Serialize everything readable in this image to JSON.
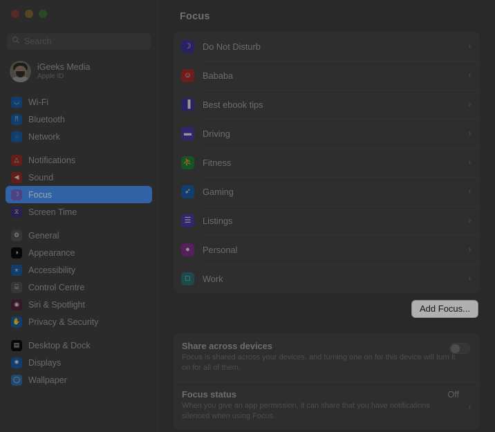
{
  "window": {
    "traffic_lights": [
      "close",
      "minimize",
      "maximize"
    ]
  },
  "sidebar": {
    "search": {
      "placeholder": "Search",
      "value": "",
      "icon": "search-icon"
    },
    "account": {
      "name": "iGeeks Media",
      "subtitle": "Apple ID",
      "avatar": "user-avatar"
    },
    "groups": [
      {
        "items": [
          {
            "label": "Wi-Fi",
            "icon": "wifi-icon",
            "color": "#1a5a9e",
            "glyph": "◡",
            "selected": false
          },
          {
            "label": "Bluetooth",
            "icon": "bluetooth-icon",
            "color": "#1a5a9e",
            "glyph": "ᛗ",
            "selected": false
          },
          {
            "label": "Network",
            "icon": "network-icon",
            "color": "#1a5a9e",
            "glyph": "◌",
            "selected": false
          }
        ]
      },
      {
        "items": [
          {
            "label": "Notifications",
            "icon": "notifications-icon",
            "color": "#8e2b26",
            "glyph": "△",
            "selected": false
          },
          {
            "label": "Sound",
            "icon": "sound-icon",
            "color": "#8e2b26",
            "glyph": "◀",
            "selected": false
          },
          {
            "label": "Focus",
            "icon": "focus-moon-icon",
            "color": "#6d5fc0",
            "glyph": "☽",
            "selected": true
          },
          {
            "label": "Screen Time",
            "icon": "screen-time-icon",
            "color": "#3b3273",
            "glyph": "⧖",
            "selected": false
          }
        ]
      },
      {
        "items": [
          {
            "label": "General",
            "icon": "general-gear-icon",
            "color": "#4f4f4f",
            "glyph": "⚙",
            "selected": false
          },
          {
            "label": "Appearance",
            "icon": "appearance-icon",
            "color": "#0c0c0c",
            "glyph": "◑",
            "selected": false
          },
          {
            "label": "Accessibility",
            "icon": "accessibility-icon",
            "color": "#1a5a9e",
            "glyph": "⚹",
            "selected": false
          },
          {
            "label": "Control Centre",
            "icon": "control-centre-icon",
            "color": "#4f4f4f",
            "glyph": "⌸",
            "selected": false
          },
          {
            "label": "Siri & Spotlight",
            "icon": "siri-icon",
            "color": "#4b2336",
            "glyph": "◉",
            "selected": false
          },
          {
            "label": "Privacy & Security",
            "icon": "privacy-hand-icon",
            "color": "#1a5a9e",
            "glyph": "✋",
            "selected": false
          }
        ]
      },
      {
        "items": [
          {
            "label": "Desktop & Dock",
            "icon": "desktop-dock-icon",
            "color": "#0c0c0c",
            "glyph": "▤",
            "selected": false
          },
          {
            "label": "Displays",
            "icon": "displays-icon",
            "color": "#1a5a9e",
            "glyph": "✹",
            "selected": false
          },
          {
            "label": "Wallpaper",
            "icon": "wallpaper-icon",
            "color": "#2a6a9e",
            "glyph": "◯",
            "selected": false
          }
        ]
      }
    ]
  },
  "main": {
    "title": "Focus",
    "focus_items": [
      {
        "label": "Do Not Disturb",
        "icon": "moon-icon",
        "color": "#3b3391",
        "glyph": "☽",
        "chevron": "›"
      },
      {
        "label": "Bababa",
        "icon": "smiley-icon",
        "color": "#9d2b28",
        "glyph": "☺",
        "chevron": "›"
      },
      {
        "label": "Best ebook tips",
        "icon": "chart-book-icon",
        "color": "#3b3391",
        "glyph": "▐",
        "chevron": "›"
      },
      {
        "label": "Driving",
        "icon": "car-icon",
        "color": "#45399b",
        "glyph": "▬",
        "chevron": "›"
      },
      {
        "label": "Fitness",
        "icon": "running-icon",
        "color": "#1f7a33",
        "glyph": "⛹",
        "chevron": "›"
      },
      {
        "label": "Gaming",
        "icon": "rocket-icon",
        "color": "#1a5a9e",
        "glyph": "➶",
        "chevron": "›"
      },
      {
        "label": "Listings",
        "icon": "list-icon",
        "color": "#45399b",
        "glyph": "☰",
        "chevron": "›"
      },
      {
        "label": "Personal",
        "icon": "person-icon",
        "color": "#7a2f86",
        "glyph": "●",
        "chevron": "›"
      },
      {
        "label": "Work",
        "icon": "briefcase-icon",
        "color": "#2b6a6d",
        "glyph": "□",
        "chevron": "›"
      }
    ],
    "add_focus_label": "Add Focus...",
    "share_across_devices": {
      "title": "Share across devices",
      "description": "Focus is shared across your devices, and turning one on for this device will turn it on for all of them.",
      "toggle_state": "off"
    },
    "focus_status": {
      "title": "Focus status",
      "description": "When you give an app permission, it can share that you have notifications silenced when using Focus.",
      "value": "Off",
      "chevron": "›"
    }
  },
  "colors": {
    "accent_blue": "#4a8ef0",
    "sidebar_bg": "#3e3e3e",
    "main_bg": "#3c3c3c",
    "card_bg": "#434343",
    "button_white": "#fdfdfd"
  }
}
